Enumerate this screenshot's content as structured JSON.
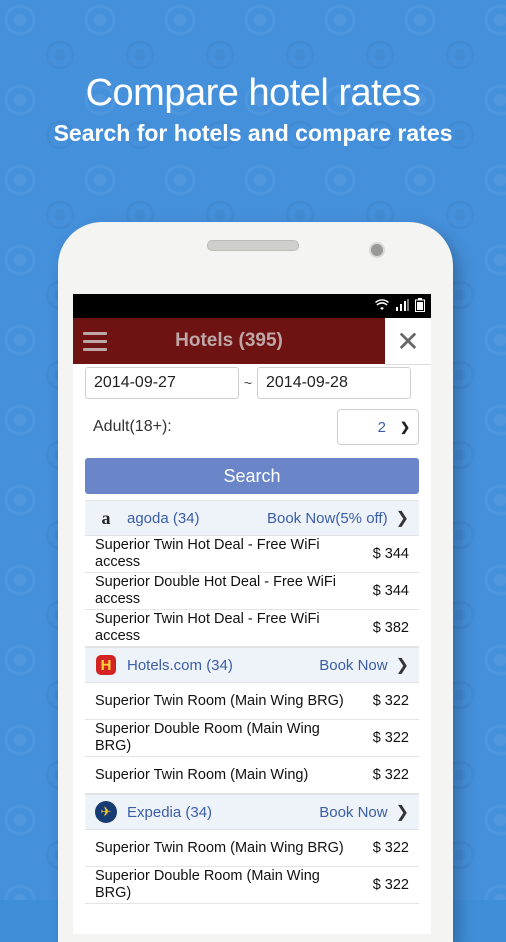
{
  "promo": {
    "title": "Compare hotel rates",
    "subtitle": "Search for hotels and compare rates"
  },
  "app_bar": {
    "title": "Hotels (395)",
    "close_label": "✕"
  },
  "search": {
    "checkin": "2014-09-27",
    "separator": "~",
    "checkout": "2014-09-28",
    "adult_label": "Adult(18+):",
    "adult_value": "2",
    "search_label": "Search"
  },
  "providers": [
    {
      "name": "agoda (34)",
      "cta": "Book Now(5% off)",
      "logo_icon": "agoda-logo",
      "logo_glyph": "a",
      "rooms": [
        {
          "name": "Superior Twin Hot Deal - Free WiFi access",
          "price": "$ 344"
        },
        {
          "name": "Superior Double Hot Deal - Free WiFi access",
          "price": "$ 344"
        },
        {
          "name": "Superior Twin Hot Deal - Free WiFi access",
          "price": "$ 382"
        }
      ]
    },
    {
      "name": "Hotels.com (34)",
      "cta": "Book Now",
      "logo_icon": "hotels-com-logo",
      "logo_glyph": "H",
      "rooms": [
        {
          "name": "Superior Twin Room (Main Wing BRG)",
          "price": "$ 322"
        },
        {
          "name": "Superior Double Room (Main Wing BRG)",
          "price": "$ 322"
        },
        {
          "name": "Superior Twin Room (Main Wing)",
          "price": "$ 322"
        }
      ]
    },
    {
      "name": "Expedia (34)",
      "cta": "Book Now",
      "logo_icon": "expedia-logo",
      "logo_glyph": "✈",
      "rooms": [
        {
          "name": "Superior Twin Room (Main Wing BRG)",
          "price": "$ 322"
        },
        {
          "name": "Superior Double Room (Main Wing BRG)",
          "price": "$ 322"
        }
      ]
    }
  ],
  "colors": {
    "background": "#4590db",
    "app_bar": "#6e1212",
    "search_button": "#6a86c8",
    "link": "#3b5ea8"
  }
}
